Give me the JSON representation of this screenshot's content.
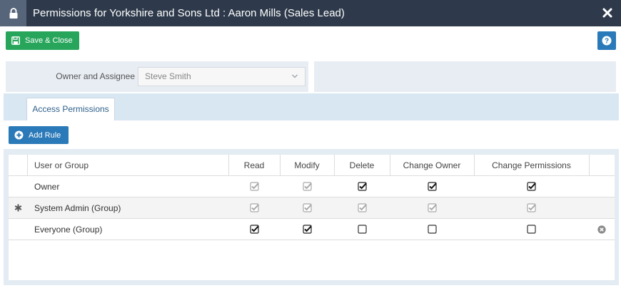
{
  "window": {
    "title": "Permissions for Yorkshire and Sons Ltd : Aaron Mills (Sales Lead)",
    "lock_icon": "lock-icon",
    "close_icon": "close-icon"
  },
  "toolbar": {
    "save_label": "Save & Close",
    "help_icon": "question-circle-icon"
  },
  "owner": {
    "label": "Owner and Assignee",
    "value": "Steve Smith"
  },
  "tabs": [
    {
      "label": "Access Permissions",
      "active": true
    }
  ],
  "add_rule_label": "Add Rule",
  "grid": {
    "columns": [
      "User or Group",
      "Read",
      "Modify",
      "Delete",
      "Change Owner",
      "Change Permissions"
    ],
    "rows": [
      {
        "name": "Owner",
        "marker": "",
        "read": "checked-disabled",
        "modify": "checked-disabled",
        "delete": "checked",
        "change_owner": "checked",
        "change_permissions": "checked",
        "removable": false
      },
      {
        "name": "System Admin (Group)",
        "marker": "asterisk",
        "read": "checked-disabled",
        "modify": "checked-disabled",
        "delete": "checked-disabled",
        "change_owner": "checked-disabled",
        "change_permissions": "checked-disabled",
        "removable": false
      },
      {
        "name": "Everyone (Group)",
        "marker": "",
        "read": "checked",
        "modify": "checked",
        "delete": "unchecked",
        "change_owner": "unchecked",
        "change_permissions": "unchecked",
        "removable": true
      }
    ]
  },
  "colors": {
    "titlebar": "#2e3a4b",
    "save_green": "#27a65b",
    "action_blue": "#2a79b8",
    "panel_bg": "#e8edf4"
  }
}
